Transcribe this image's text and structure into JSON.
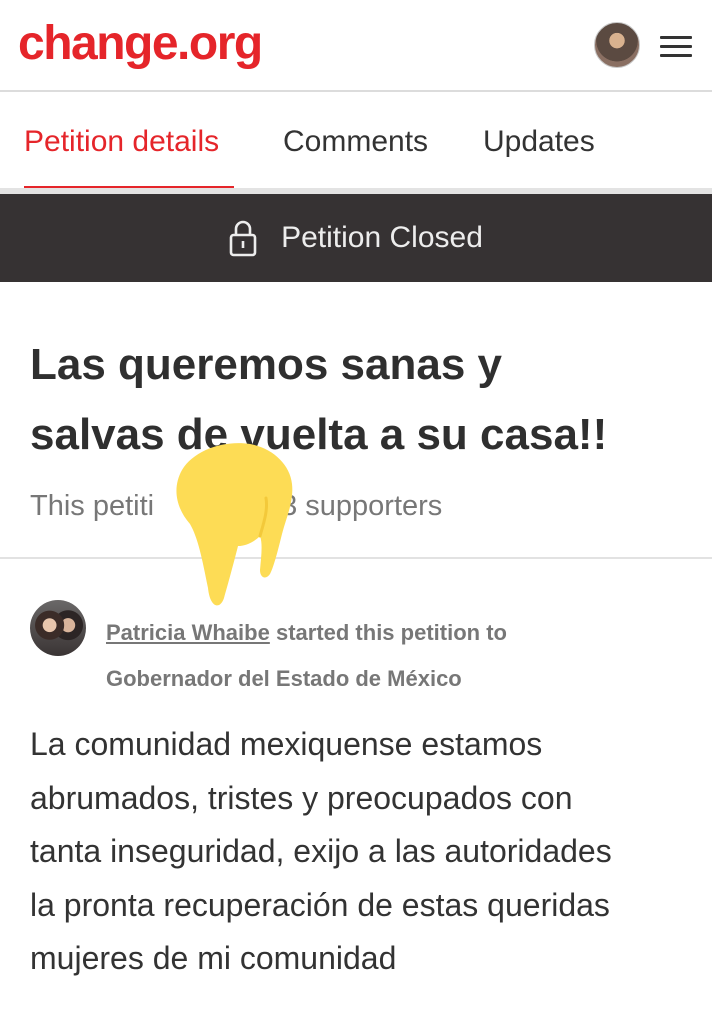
{
  "header": {
    "logo_text": "change.org",
    "brand_color": "#e5252a",
    "avatar_icon": "user-avatar",
    "menu_icon": "hamburger-menu-icon"
  },
  "tabs": [
    {
      "label": "Petition details",
      "active": true
    },
    {
      "label": "Comments",
      "active": false
    },
    {
      "label": "Updates",
      "active": false
    }
  ],
  "status_banner": {
    "icon": "lock-icon",
    "text": "Petition Closed",
    "background": "#363233"
  },
  "petition": {
    "title_line1": "Las queremos sanas y",
    "title_line2": "salvas de vuelta a su casa!!",
    "supporters_prefix": "This petiti",
    "supporters_suffix": "3 supporters",
    "starter_name": "Patricia Whaibe",
    "starter_action": " started this petition to",
    "target": "Gobernador del Estado de México",
    "body_lines": [
      "La comunidad mexiquense estamos",
      "abrumados, tristes y preocupados con",
      "tanta inseguridad, exijo a las autoridades",
      "la pronta recuperación de estas queridas",
      "mujeres de mi comunidad"
    ]
  },
  "overlay": {
    "icon": "pointing-hand-emoji-icon",
    "color": "#fddc55"
  }
}
